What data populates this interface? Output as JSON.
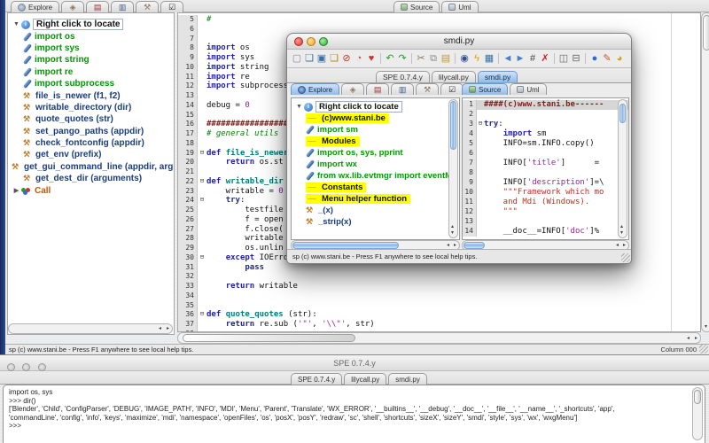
{
  "shared": {
    "explore_label": "Explore",
    "source_label": "Source",
    "uml_label": "Uml",
    "tree_root": "Right click to locate",
    "help_text": "sp  (c) www.stani.be - Press F1 anywhere to see local help tips.",
    "icon_tabs": [
      {
        "name": "index-tab",
        "glyph": "◈",
        "color": "#8a7a55"
      },
      {
        "name": "output-tab",
        "glyph": "▤",
        "color": "#a03030"
      },
      {
        "name": "notes-tab",
        "glyph": "▥",
        "color": "#3a5a8c"
      },
      {
        "name": "todo-tab",
        "glyph": "⚒",
        "color": "#8c7a5a"
      },
      {
        "name": "check-tab",
        "glyph": "☑",
        "color": "#222222"
      }
    ]
  },
  "main_window": {
    "tree_items": [
      {
        "kind": "import",
        "label": "import os"
      },
      {
        "kind": "import",
        "label": "import sys"
      },
      {
        "kind": "import",
        "label": "import string"
      },
      {
        "kind": "import",
        "label": "import re"
      },
      {
        "kind": "import",
        "label": "import subprocess"
      },
      {
        "kind": "func",
        "label": "file_is_newer (f1, f2)"
      },
      {
        "kind": "func",
        "label": "writable_directory (dir)"
      },
      {
        "kind": "func",
        "label": "quote_quotes (str)"
      },
      {
        "kind": "func",
        "label": "set_pango_paths (appdir)"
      },
      {
        "kind": "func",
        "label": "check_fontconfig (appdir)"
      },
      {
        "kind": "func",
        "label": "get_env (prefix)"
      },
      {
        "kind": "func",
        "label": "get_gui_command_line (appdir, args)"
      },
      {
        "kind": "func",
        "label": "get_dest_dir (arguments)"
      },
      {
        "kind": "call",
        "label": "Call"
      }
    ],
    "editor": {
      "first_line": 5,
      "last_line": 38,
      "lines": [
        {
          "n": 5,
          "tokens": [
            [
              "com",
              "#"
            ]
          ]
        },
        {
          "n": 8,
          "tokens": [
            [
              "kw",
              "import"
            ],
            [
              "pl",
              " os"
            ]
          ]
        },
        {
          "n": 9,
          "tokens": [
            [
              "kw",
              "import"
            ],
            [
              "pl",
              " sys"
            ]
          ]
        },
        {
          "n": 10,
          "tokens": [
            [
              "kw",
              "import"
            ],
            [
              "pl",
              " string"
            ]
          ]
        },
        {
          "n": 11,
          "tokens": [
            [
              "kw",
              "import"
            ],
            [
              "pl",
              " re"
            ]
          ]
        },
        {
          "n": 12,
          "tokens": [
            [
              "kw",
              "import"
            ],
            [
              "pl",
              " subprocess"
            ]
          ]
        },
        {
          "n": 14,
          "tokens": [
            [
              "pl",
              "debug = "
            ],
            [
              "num",
              "0"
            ]
          ]
        },
        {
          "n": 16,
          "tokens": [
            [
              "comred",
              "#############################################"
            ]
          ]
        },
        {
          "n": 17,
          "tokens": [
            [
              "com",
              "# general utils"
            ]
          ]
        },
        {
          "n": 19,
          "fold": true,
          "tokens": [
            [
              "kw",
              "def"
            ],
            [
              "pl",
              " "
            ],
            [
              "fn",
              "file_is_newer"
            ],
            [
              "pl",
              " (f1, f2):"
            ]
          ]
        },
        {
          "n": 20,
          "tokens": [
            [
              "pl",
              "    "
            ],
            [
              "kw",
              "return"
            ],
            [
              "pl",
              " os.st"
            ]
          ]
        },
        {
          "n": 22,
          "fold": true,
          "tokens": [
            [
              "kw",
              "def"
            ],
            [
              "pl",
              " "
            ],
            [
              "fn",
              "writable_dir"
            ]
          ]
        },
        {
          "n": 23,
          "tokens": [
            [
              "pl",
              "    writable = "
            ],
            [
              "num",
              "0"
            ]
          ]
        },
        {
          "n": 24,
          "fold": true,
          "tokens": [
            [
              "pl",
              "    "
            ],
            [
              "kw",
              "try"
            ],
            [
              "pl",
              ":"
            ]
          ]
        },
        {
          "n": 25,
          "tokens": [
            [
              "pl",
              "        testfile"
            ]
          ]
        },
        {
          "n": 26,
          "tokens": [
            [
              "pl",
              "        f = open"
            ]
          ]
        },
        {
          "n": 27,
          "tokens": [
            [
              "pl",
              "        f.close("
            ]
          ]
        },
        {
          "n": 28,
          "tokens": [
            [
              "pl",
              "        writable"
            ]
          ]
        },
        {
          "n": 29,
          "tokens": [
            [
              "pl",
              "        os.unlin"
            ]
          ]
        },
        {
          "n": 30,
          "fold": true,
          "tokens": [
            [
              "pl",
              "    "
            ],
            [
              "kw",
              "except"
            ],
            [
              "pl",
              " IOError:"
            ]
          ]
        },
        {
          "n": 31,
          "tokens": [
            [
              "pl",
              "        "
            ],
            [
              "kw",
              "pass"
            ]
          ]
        },
        {
          "n": 33,
          "tokens": [
            [
              "pl",
              "    "
            ],
            [
              "kw",
              "return"
            ],
            [
              "pl",
              " writable"
            ]
          ]
        },
        {
          "n": 36,
          "fold": true,
          "tokens": [
            [
              "kw",
              "def"
            ],
            [
              "pl",
              " "
            ],
            [
              "fn",
              "quote_quotes"
            ],
            [
              "pl",
              " (str):"
            ]
          ]
        },
        {
          "n": 37,
          "tokens": [
            [
              "pl",
              "    "
            ],
            [
              "kw",
              "return"
            ],
            [
              "pl",
              " re.sub ("
            ],
            [
              "strq",
              "'\"'"
            ],
            [
              "pl",
              ", "
            ],
            [
              "strq",
              "'\\\\\"'"
            ],
            [
              "pl",
              ", str)"
            ]
          ]
        }
      ]
    },
    "status": {
      "help": "sp  (c) www.stani.be - Press F1 anywhere to see local help tips.",
      "column": "Column 000"
    }
  },
  "float_window": {
    "title": "smdi.py",
    "toolbar": [
      {
        "name": "new-icon",
        "glyph": "▢",
        "color": "#7f8c9a"
      },
      {
        "name": "open-icon",
        "glyph": "❏",
        "color": "#3a6ea5"
      },
      {
        "name": "save-icon",
        "glyph": "▣",
        "color": "#3a6ea5"
      },
      {
        "name": "save-all-icon",
        "glyph": "❏",
        "color": "#b8860b"
      },
      {
        "name": "close-icon",
        "glyph": "⊘",
        "color": "#cc3322"
      },
      {
        "name": "recent-icon",
        "glyph": "◔",
        "color": "#cc4444"
      },
      {
        "name": "favorite-icon",
        "glyph": "♥",
        "color": "#d03030"
      },
      {
        "sep": true
      },
      {
        "name": "undo-icon",
        "glyph": "↶",
        "color": "#2a9a2a"
      },
      {
        "name": "redo-icon",
        "glyph": "↷",
        "color": "#2a9a2a"
      },
      {
        "sep": true
      },
      {
        "name": "cut-icon",
        "glyph": "✂",
        "color": "#88775f"
      },
      {
        "name": "copy-icon",
        "glyph": "⧉",
        "color": "#8a8a8a"
      },
      {
        "name": "paste-icon",
        "glyph": "▤",
        "color": "#c09a30"
      },
      {
        "sep": true
      },
      {
        "name": "find-icon",
        "glyph": "◉",
        "color": "#35508c"
      },
      {
        "name": "refresh-icon",
        "glyph": "ϟ",
        "color": "#d8a000"
      },
      {
        "name": "replace-icon",
        "glyph": "▦",
        "color": "#3a6ea5"
      },
      {
        "sep": true
      },
      {
        "name": "back-icon",
        "glyph": "◄",
        "color": "#4a7ec8"
      },
      {
        "name": "forward-icon",
        "glyph": "►",
        "color": "#4a7ec8"
      },
      {
        "name": "goto-line-icon",
        "glyph": "#",
        "color": "#444444"
      },
      {
        "name": "strip-icon",
        "glyph": "✗",
        "color": "#cc2222"
      },
      {
        "sep": true
      },
      {
        "name": "split-vertical-icon",
        "glyph": "◫",
        "color": "#666666"
      },
      {
        "name": "split-horizontal-icon",
        "glyph": "⊟",
        "color": "#666666"
      },
      {
        "sep": true
      },
      {
        "name": "browser-icon",
        "glyph": "●",
        "color": "#2a6acc"
      },
      {
        "name": "paint-icon",
        "glyph": "✎",
        "color": "#cc5522"
      },
      {
        "name": "donate-icon",
        "glyph": "◕",
        "color": "#d4a017"
      }
    ],
    "doc_tabs": [
      {
        "label": "SPE 0.7.4.y",
        "active": false
      },
      {
        "label": "lilycall.py",
        "active": false
      },
      {
        "label": "smdi.py",
        "active": true
      }
    ],
    "tree_items": [
      {
        "kind": "section",
        "label": "(c)www.stani.be"
      },
      {
        "kind": "import",
        "label": "import sm"
      },
      {
        "kind": "section",
        "label": "Modules"
      },
      {
        "kind": "import",
        "label": "import  os, sys, pprint"
      },
      {
        "kind": "import",
        "label": "import  wx"
      },
      {
        "kind": "import",
        "label": "from    wx.lib.evtmgr import eventM"
      },
      {
        "kind": "section",
        "label": "Constants"
      },
      {
        "kind": "section",
        "label": "Menu helper function"
      },
      {
        "kind": "func",
        "label": "_(x)"
      },
      {
        "kind": "func",
        "label": "_strip(x)"
      }
    ],
    "source": {
      "first_line": 1,
      "last_line": 14,
      "lines": [
        {
          "n": 1,
          "bg": true,
          "tokens": [
            [
              "comred",
              "####(c)www.stani.be------"
            ]
          ]
        },
        {
          "n": 3,
          "fold": true,
          "tokens": [
            [
              "kw",
              "try"
            ],
            [
              "pl",
              ":"
            ]
          ]
        },
        {
          "n": 4,
          "tokens": [
            [
              "pl",
              "    "
            ],
            [
              "kw",
              "import"
            ],
            [
              "pl",
              " sm"
            ]
          ]
        },
        {
          "n": 5,
          "tokens": [
            [
              "pl",
              "    INFO=sm.INFO.copy()"
            ]
          ]
        },
        {
          "n": 7,
          "tokens": [
            [
              "pl",
              "    INFO["
            ],
            [
              "strq",
              "'title'"
            ],
            [
              "pl",
              "]      = "
            ]
          ]
        },
        {
          "n": 9,
          "tokens": [
            [
              "pl",
              "    INFO["
            ],
            [
              "strq",
              "'description'"
            ],
            [
              "pl",
              "]=\\"
            ]
          ]
        },
        {
          "n": 10,
          "tokens": [
            [
              "str",
              "    \"\"\"Framework which mo"
            ]
          ]
        },
        {
          "n": 11,
          "tokens": [
            [
              "str",
              "    and Mdi (Windows)."
            ]
          ]
        },
        {
          "n": 12,
          "tokens": [
            [
              "str",
              "    \"\"\""
            ]
          ]
        },
        {
          "n": 14,
          "tokens": [
            [
              "pl",
              "    __doc__=INFO["
            ],
            [
              "strq",
              "'doc'"
            ],
            [
              "pl",
              "]%"
            ]
          ]
        }
      ]
    },
    "status": "sp  (c) www.stani.be - Press F1 anywhere to see local help tips."
  },
  "bottom_window": {
    "title": "SPE 0.7.4.y",
    "tabs": [
      "SPE 0.7.4.y",
      "lilycall.py",
      "smdi.py"
    ],
    "shell_lines": [
      "import os, sys",
      ">>> dir()",
      "['Blender', 'Child', 'ConfigParser', 'DEBUG', 'IMAGE_PATH', 'INFO', 'MDI', 'Menu', 'Parent', 'Translate', 'WX_ERROR', '__builtins__', '__debug', '__doc__', '__file__', '__name__', '_shortcuts', 'app',",
      "'commandLine', 'config', 'info', 'keys', 'maximize', 'mdi', 'namespace', 'openFiles', 'os', 'posX', 'posY', 'redraw', 'sc', 'shell', 'shortcuts', 'sizeX', 'sizeY', 'smdi', 'style', 'sys', 'wx', 'wxgMenu']",
      ">>>"
    ]
  }
}
